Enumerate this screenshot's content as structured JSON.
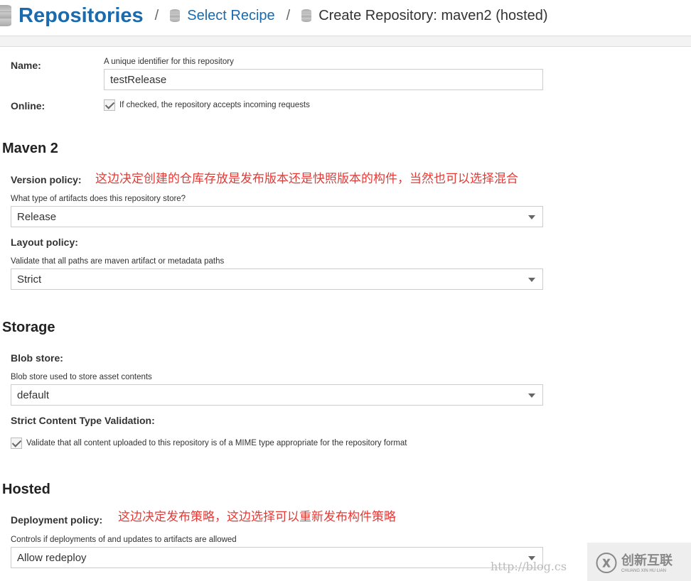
{
  "breadcrumb": {
    "root": "Repositories",
    "sep": "/",
    "step1": "Select Recipe",
    "current": "Create Repository: maven2 (hosted)"
  },
  "name": {
    "label": "Name:",
    "help": "A unique identifier for this repository",
    "value": "testRelease"
  },
  "online": {
    "label": "Online:",
    "help": "If checked, the repository accepts incoming requests",
    "checked": true
  },
  "maven": {
    "heading": "Maven 2",
    "version": {
      "label": "Version policy:",
      "note": "这边决定创建的仓库存放是发布版本还是快照版本的构件，当然也可以选择混合",
      "help": "What type of artifacts does this repository store?",
      "value": "Release"
    },
    "layout": {
      "label": "Layout policy:",
      "help": "Validate that all paths are maven artifact or metadata paths",
      "value": "Strict"
    }
  },
  "storage": {
    "heading": "Storage",
    "blob": {
      "label": "Blob store:",
      "help": "Blob store used to store asset contents",
      "value": "default"
    },
    "strict": {
      "label": "Strict Content Type Validation:",
      "help": "Validate that all content uploaded to this repository is of a MIME type appropriate for the repository format",
      "checked": true
    }
  },
  "hosted": {
    "heading": "Hosted",
    "deploy": {
      "label": "Deployment policy:",
      "note": "这边决定发布策略，这边选择可以重新发布构件策略",
      "help": "Controls if deployments of and updates to artifacts are allowed",
      "value": "Allow redeploy"
    }
  },
  "watermark": {
    "url": "http://blog.cs",
    "logo": "创新互联",
    "logo_sub": "CHUANG XIN HU LIAN"
  }
}
